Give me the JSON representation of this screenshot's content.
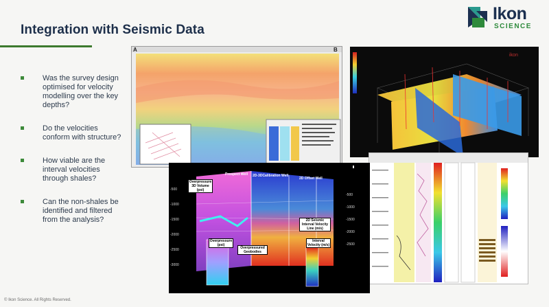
{
  "slide": {
    "title": "Integration with Seismic Data",
    "copyright": "© Ikon Science. All Rights Reserved."
  },
  "logo": {
    "name": "Ikon",
    "tagline": "SCIENCE"
  },
  "bullets": [
    "Was the survey design optimised for velocity modelling over the key depths?",
    "Do the velocities conform with structure?",
    "How viable are the interval velocities through shales?",
    "Can the non-shales be identified and filtered from the analysis?"
  ],
  "section_panel": {
    "left_label": "A",
    "right_label": "B"
  },
  "well_panel": {
    "wells": [
      "Prospect Well",
      "2D-3DCalibration Well",
      "2D Offset Well"
    ],
    "overpressure_volume": "Overpressure 3D Volume (psi)",
    "interval_velocity_line": "2D Seismic Interval Velocity Line (m/s)",
    "overpressure_legend": "Overpressure (psi)",
    "geobodies": "Overpressured Geobodies",
    "velocity_legend": "Interval Velocity (m/s)",
    "depths_left": [
      "-500",
      "-1000",
      "-1500",
      "-2000",
      "-2500",
      "-3000"
    ],
    "depths_right": [
      "-500",
      "-1000",
      "-1500",
      "-2000",
      "-2500"
    ]
  },
  "colors": {
    "title": "#1d2f4a",
    "accent_green": "#3d7a2e",
    "logo_blue": "#1c3050",
    "logo_green": "#2e8a3b"
  }
}
